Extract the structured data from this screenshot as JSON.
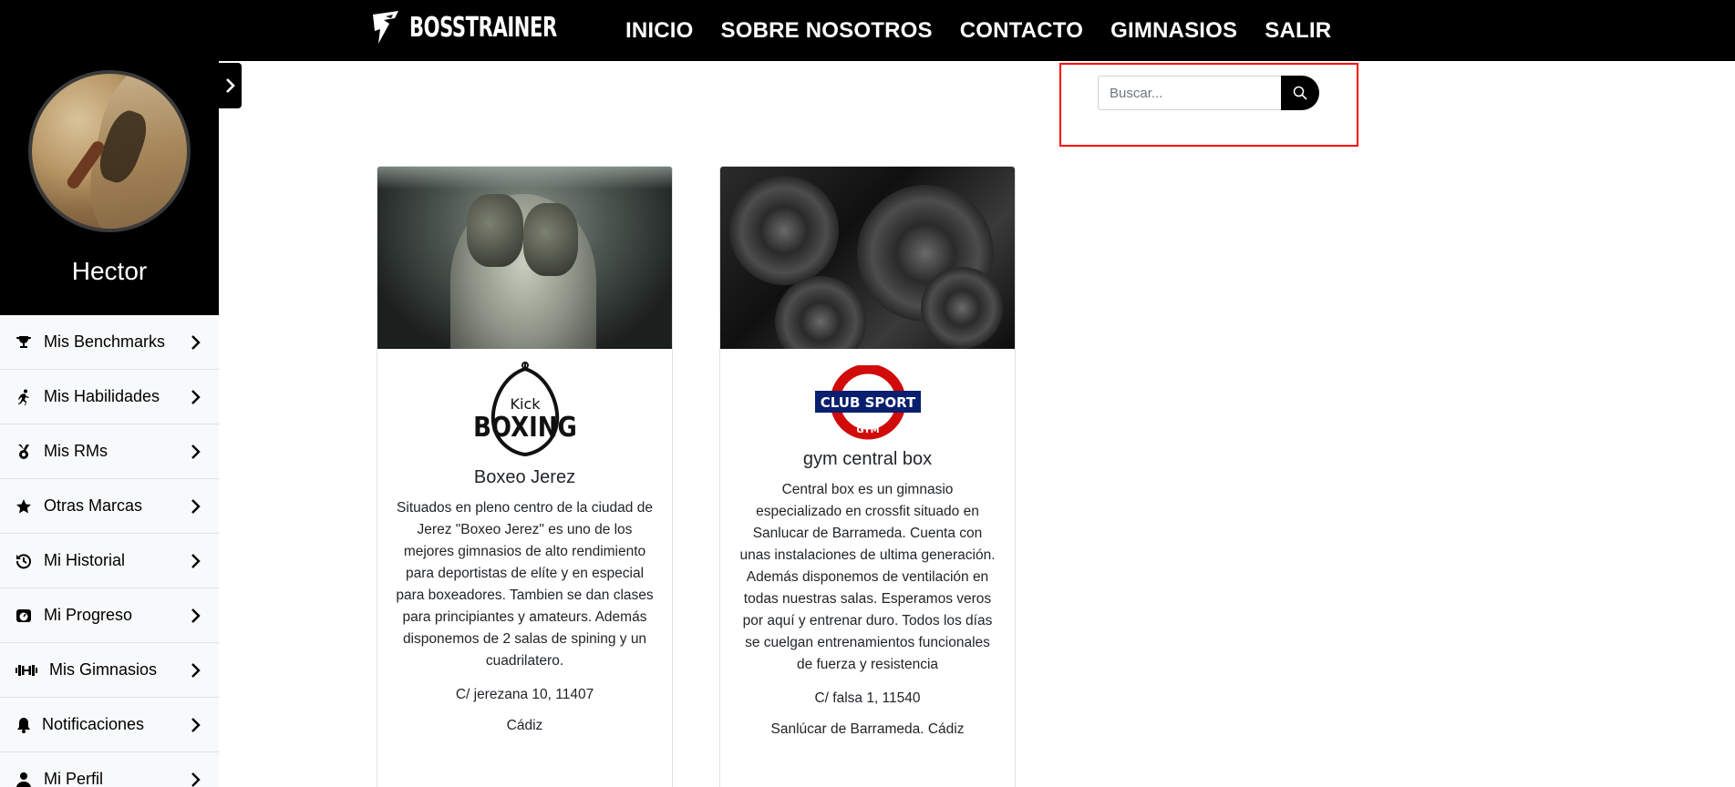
{
  "brand": {
    "name": "BOSSTRAINER"
  },
  "nav": [
    "INICIO",
    "SOBRE NOSOTROS",
    "CONTACTO",
    "GIMNASIOS",
    "SALIR"
  ],
  "user": {
    "name": "Hector"
  },
  "sidebar": {
    "items": [
      {
        "label": "Mis Benchmarks",
        "icon": "trophy-icon"
      },
      {
        "label": "Mis Habilidades",
        "icon": "running-icon"
      },
      {
        "label": "Mis RMs",
        "icon": "medal-icon"
      },
      {
        "label": "Otras Marcas",
        "icon": "star-icon"
      },
      {
        "label": "Mi Historial",
        "icon": "history-icon"
      },
      {
        "label": "Mi Progreso",
        "icon": "progress-icon"
      },
      {
        "label": "Mis Gimnasios",
        "icon": "dumbbell-icon"
      },
      {
        "label": "Notificaciones",
        "icon": "bell-icon"
      },
      {
        "label": "Mi Perfil",
        "icon": "user-icon"
      }
    ]
  },
  "search": {
    "placeholder": "Buscar..."
  },
  "gyms": [
    {
      "logo_text_top": "Kick",
      "logo_text": "BOXING",
      "name": "Boxeo Jerez",
      "description": "Situados en pleno centro de la ciudad de Jerez \"Boxeo Jerez\" es uno de los mejores gimnasios de alto rendimiento para deportistas de elíte y en especial para boxeadores. Tambien se dan clases para principiantes y amateurs. Además disponemos de 2 salas de spining y un cuadrilatero.",
      "address": "C/ jerezana 10, 11407",
      "city": "Cádiz"
    },
    {
      "logo_text": "CLUB SPORT",
      "logo_text_bottom": "GYM",
      "name": "gym central box",
      "description": "Central box es un gimnasio especializado en crossfit situado en Sanlucar de Barrameda. Cuenta con unas instalaciones de ultima generación. Además disponemos de ventilación en todas nuestras salas. Esperamos veros por aquí y entrenar duro. Todos los días se cuelgan entrenamientos funcionales de fuerza y resistencia",
      "address": "C/ falsa 1, 11540",
      "city": "Sanlúcar de Barrameda. Cádiz"
    }
  ]
}
